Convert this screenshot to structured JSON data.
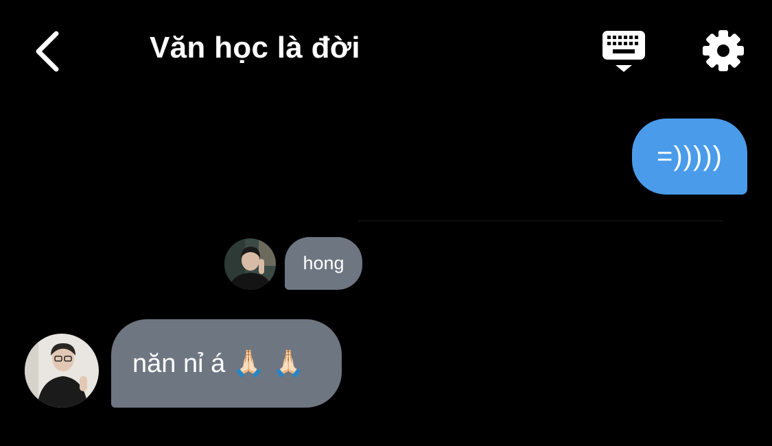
{
  "header": {
    "title": "Văn học là đời",
    "back_icon": "chevron-left-icon",
    "keyboard_icon": "keyboard-hide-icon",
    "settings_icon": "gear-icon"
  },
  "messages": [
    {
      "direction": "sent",
      "text": "=)))))"
    },
    {
      "direction": "received",
      "text": "hong",
      "avatar": "avatar-photo"
    },
    {
      "direction": "received",
      "text": "năn nỉ á 🙏🏻 🙏🏻",
      "avatar": "avatar-photo"
    }
  ],
  "colors": {
    "background": "#000000",
    "sent_bubble": "#4a9bea",
    "received_bubble": "#6e7682",
    "text": "#ffffff"
  }
}
